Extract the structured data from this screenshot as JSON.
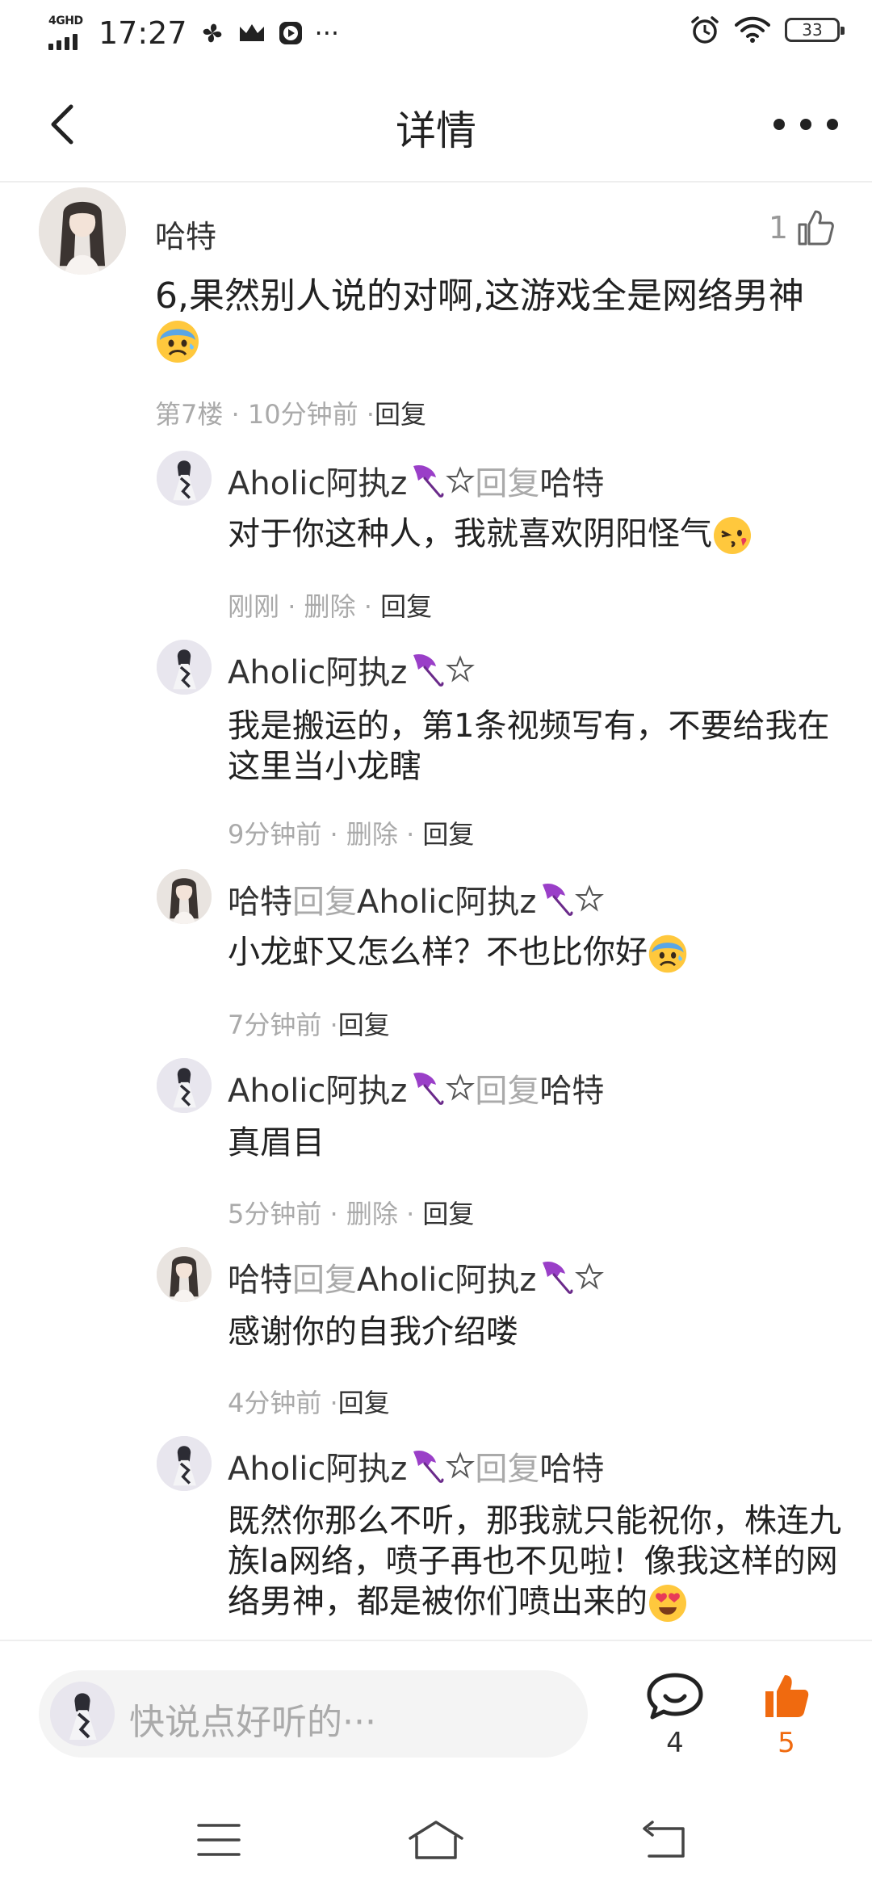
{
  "status_bar": {
    "network": "4GHD",
    "time": "17:27",
    "icons_left": [
      "fan-icon",
      "crown-icon",
      "play-icon",
      "more-dots"
    ],
    "overflow": "···",
    "battery": "33"
  },
  "nav": {
    "title": "详情"
  },
  "main_comment": {
    "author": "哈特",
    "like_count": "1",
    "text": "6,果然别人说的对啊,这游戏全是网络男神",
    "meta_floor": "第7楼",
    "meta_time": "10分钟前",
    "reply_label": "回复"
  },
  "replies": [
    {
      "author": "Aholic阿执z",
      "reply_to_label": "回复",
      "reply_to": "哈特",
      "text": "对于你这种人，我就喜欢阴阳怪气",
      "time": "刚刚",
      "delete_label": "删除",
      "reply_label": "回复"
    },
    {
      "author": "Aholic阿执z",
      "text": "我是搬运的，第1条视频写有，不要给我在这里当小龙瞎",
      "time": "9分钟前",
      "delete_label": "删除",
      "reply_label": "回复"
    },
    {
      "author": "哈特",
      "reply_to_label": "回复",
      "reply_to": "Aholic阿执z",
      "text": "小龙虾又怎么样？不也比你好",
      "time": "7分钟前",
      "reply_label": "回复"
    },
    {
      "author": "Aholic阿执z",
      "reply_to_label": "回复",
      "reply_to": "哈特",
      "text": "真眉目",
      "time": "5分钟前",
      "delete_label": "删除",
      "reply_label": "回复"
    },
    {
      "author": "哈特",
      "reply_to_label": "回复",
      "reply_to": "Aholic阿执z",
      "text": "感谢你的自我介绍喽",
      "time": "4分钟前",
      "reply_label": "回复"
    },
    {
      "author": "Aholic阿执z",
      "reply_to_label": "回复",
      "reply_to": "哈特",
      "text": "既然你那么不听，那我就只能祝你，株连九族la网络，喷子再也不见啦！像我这样的网络男神，都是被你们喷出来的"
    }
  ],
  "bottom_bar": {
    "input_placeholder": "快说点好听的···",
    "comment_count": "4",
    "like_count": "5",
    "accent_color": "#f06a0f"
  }
}
